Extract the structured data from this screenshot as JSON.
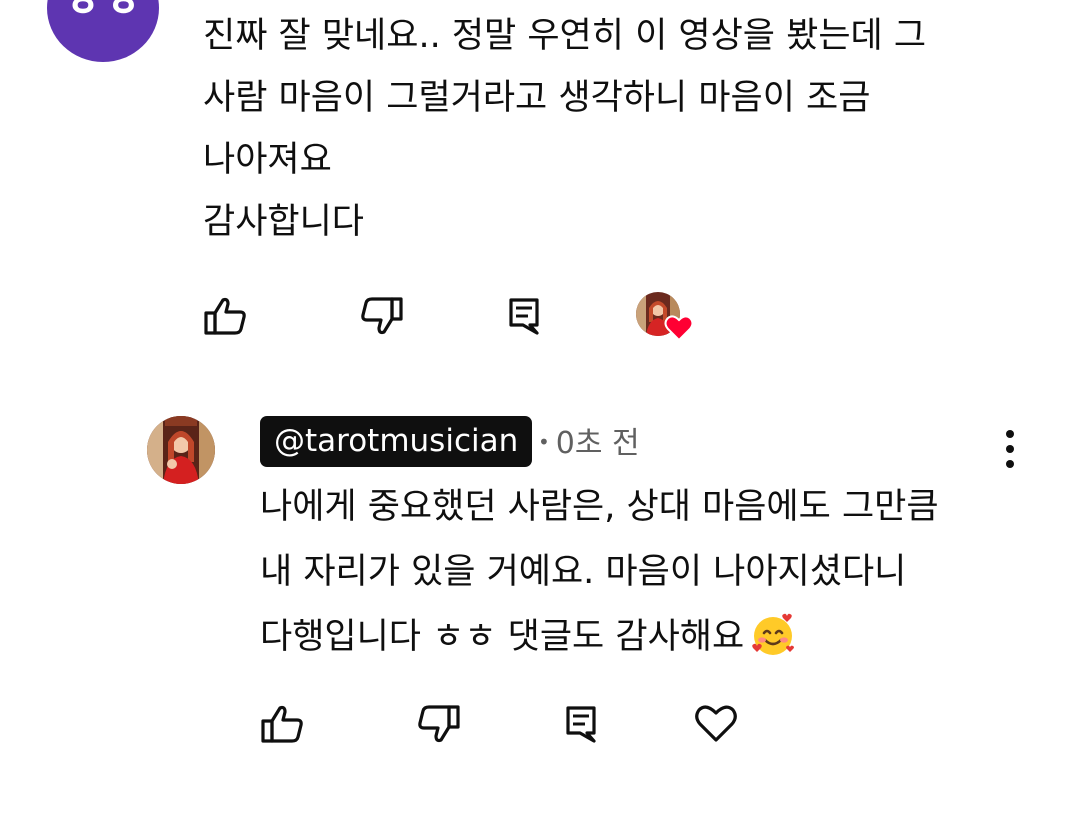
{
  "top_comment": {
    "avatar_initials": "ㅎㅎ",
    "avatar_color": "#5e35b1",
    "text": "진짜 잘 맞네요.. 정말 우연히 이 영상을 봤는데 그\n사람 마음이 그럴거라고 생각하니 마음이 조금\n나아져요\n감사합니다",
    "actions": {
      "like_icon": "thumbs-up-icon",
      "dislike_icon": "thumbs-down-icon",
      "reply_icon": "comment-icon",
      "creator_heart": "creator-heart-badge"
    }
  },
  "reply": {
    "author_handle": "@tarotmusician",
    "time": "0초 전",
    "text": "나에게 중요했던 사람은, 상대 마음에도 그만큼\n내 자리가 있을 거예요. 마음이 나아지셨다니\n다행입니다 ㅎㅎ 댓글도 감사해요",
    "emoji": "smiling-face-with-hearts",
    "actions": {
      "like_icon": "thumbs-up-icon",
      "dislike_icon": "thumbs-down-icon",
      "reply_icon": "comment-icon",
      "heart_icon": "heart-outline-icon"
    }
  },
  "colors": {
    "text": "#0f0f0f",
    "meta": "#606060",
    "heart": "#ff0033",
    "handle_badge_bg": "#0f0f0f"
  }
}
